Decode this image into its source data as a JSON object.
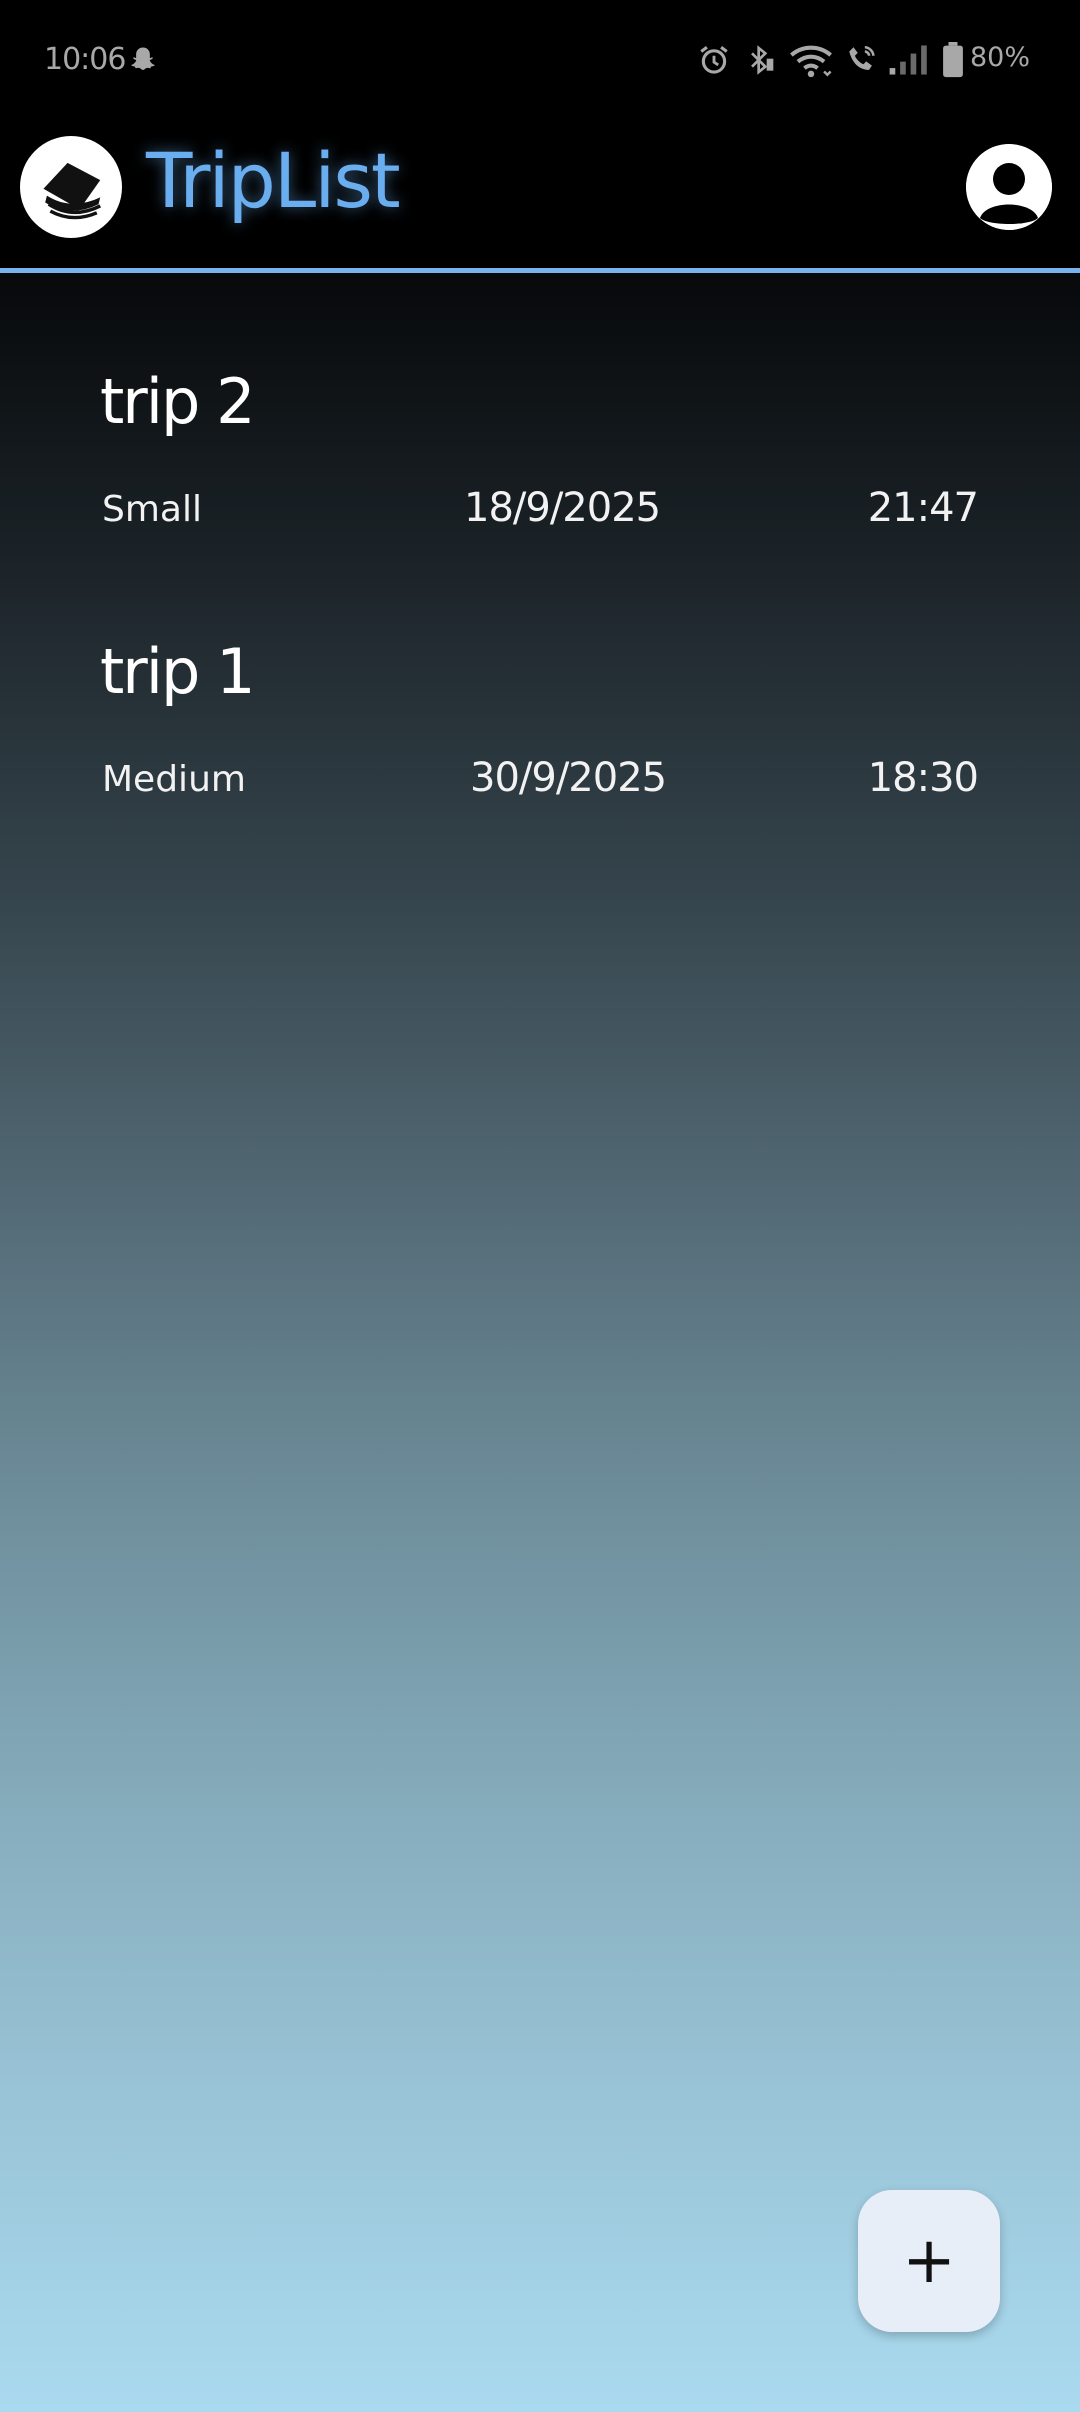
{
  "status_bar": {
    "time": "10:06",
    "battery_percent": "80%",
    "icons": [
      "snapchat-icon",
      "alarm-icon",
      "bluetooth-icon",
      "wifi-icon",
      "wifi-call-icon",
      "signal-icon",
      "battery-icon"
    ]
  },
  "app_bar": {
    "title": "TripList",
    "title_color": "#6aaef0",
    "logo_icon": "suitcase-logo-icon",
    "profile_icon": "account-icon"
  },
  "accent_color": "#79b3ee",
  "trips": [
    {
      "name": "trip 2",
      "size": "Small",
      "date": "18/9/2025",
      "time": "21:47"
    },
    {
      "name": "trip 1",
      "size": "Medium",
      "date": "30/9/2025",
      "time": "18:30"
    }
  ],
  "fab": {
    "label": "+",
    "icon": "add-icon"
  }
}
